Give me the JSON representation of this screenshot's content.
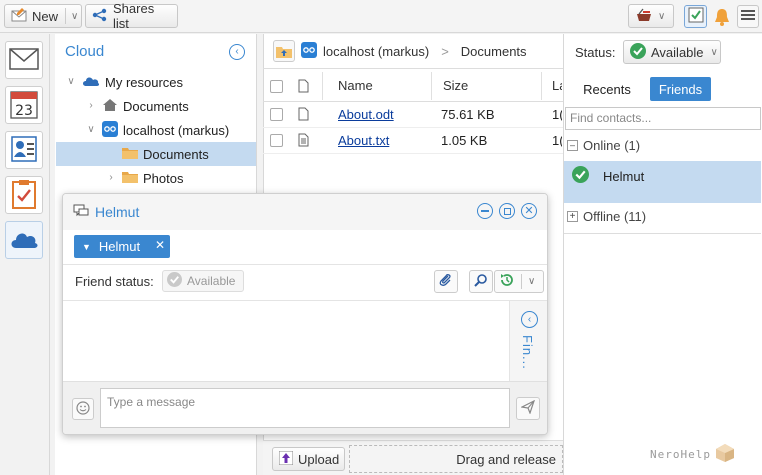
{
  "toolbar": {
    "new_label": "New",
    "shares_label": "Shares list"
  },
  "tree": {
    "title": "Cloud",
    "items": [
      {
        "label": "My resources"
      },
      {
        "label": "Documents"
      },
      {
        "label": "localhost (markus)"
      },
      {
        "label": "Documents"
      },
      {
        "label": "Photos"
      }
    ]
  },
  "filepane": {
    "breadcrumb_root": "localhost (markus)",
    "breadcrumb_sep": ">",
    "breadcrumb_current": "Documents",
    "columns": {
      "name": "Name",
      "size": "Size",
      "last": "La"
    },
    "rows": [
      {
        "name": "About.odt",
        "size": "75.61 KB",
        "cut": "1("
      },
      {
        "name": "About.txt",
        "size": "1.05 KB",
        "cut": "1("
      }
    ],
    "upload_label": "Upload",
    "drag_label": "Drag and release"
  },
  "chat": {
    "title": "Helmut",
    "recipient": "Helmut",
    "friend_status_label": "Friend status:",
    "friend_status_value": "Available",
    "side_label": "Fin...",
    "message_placeholder": "Type a message"
  },
  "contacts": {
    "status_label": "Status:",
    "status_value": "Available",
    "tab_recents": "Recents",
    "tab_friends": "Friends",
    "search_placeholder": "Find contacts...",
    "online_label": "Online (1)",
    "online_contact": "Helmut",
    "offline_label": "Offline (11)"
  },
  "branding": {
    "logo_text": "NeroHelp"
  },
  "colors": {
    "accent": "#3a87d0",
    "selection": "#c4daf0",
    "available_green": "#3aa35a"
  }
}
